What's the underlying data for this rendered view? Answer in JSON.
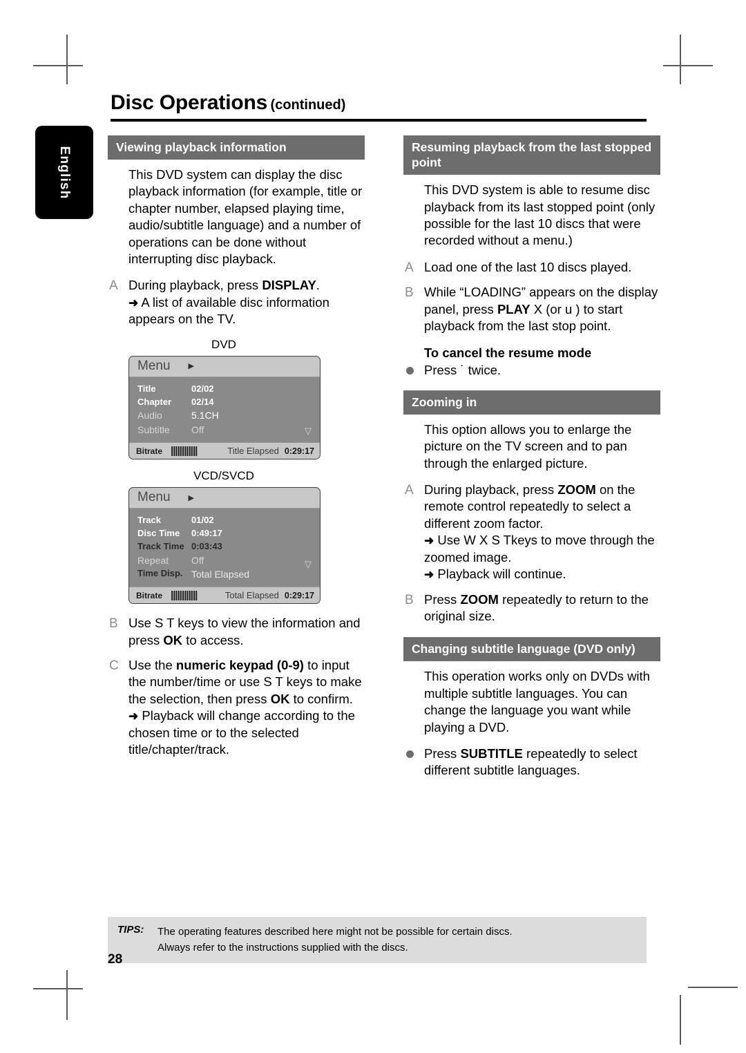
{
  "page": {
    "title_main": "Disc Operations",
    "title_sub": "(continued)",
    "language_tab": "English",
    "page_number": "28"
  },
  "left_column": {
    "section": {
      "heading": "Viewing playback information",
      "intro": "This DVD system can display the disc playback information (for example, title or chapter number, elapsed playing time, audio/subtitle language) and a number of operations can be done without interrupting disc playback.",
      "step_a": {
        "marker": "A",
        "text_before": "During playback, press ",
        "bold": "DISPLAY",
        "text_after": ".",
        "result_arrow": "➜",
        "result": "A list of available disc information appears on the TV."
      },
      "step_b": {
        "marker": "B",
        "text_before": "Use  S T keys to view the information and press ",
        "bold": "OK",
        "text_after": " to access."
      },
      "step_c": {
        "marker": "C",
        "part1": "Use the ",
        "bold1": "numeric keypad (0-9)",
        "part2": " to input the number/time or use  S T keys to make the selection, then press ",
        "bold2": "OK",
        "part3": " to confirm.",
        "result_arrow": "➜",
        "result": "Playback will change according to the chosen time or to the selected title/chapter/track."
      }
    },
    "osd_dvd": {
      "caption": "DVD",
      "menu_label": "Menu",
      "caret": "▶",
      "rows": [
        {
          "key": "Title",
          "value": "02/02",
          "style": "hl"
        },
        {
          "key": "Chapter",
          "value": "02/14",
          "style": "hl"
        },
        {
          "key": "Audio",
          "value": "5.1CH",
          "style": "dim"
        },
        {
          "key": "Subtitle",
          "value": "Off",
          "style": "dim"
        }
      ],
      "down_arrow": "▽",
      "footer": {
        "bitrate_label": "Bitrate",
        "bitrate_bars": "||||||||||||",
        "elapsed_label": "Title Elapsed",
        "elapsed_value": "0:29:17"
      }
    },
    "osd_vcd": {
      "caption": "VCD/SVCD",
      "menu_label": "Menu",
      "caret": "▶",
      "rows": [
        {
          "key": "Track",
          "value": "01/02",
          "style": "hl"
        },
        {
          "key": "Disc Time",
          "value": "0:49:17",
          "style": "hl"
        },
        {
          "key": "Track Time",
          "value": "0:03:43",
          "style": "dark"
        },
        {
          "key": "Repeat",
          "value": "Off",
          "style": "dim"
        },
        {
          "key": "Time Disp.",
          "value": "Total Elapsed",
          "style": "dim"
        }
      ],
      "down_arrow": "▽",
      "footer": {
        "bitrate_label": "Bitrate",
        "bitrate_bars": "||||||||||||",
        "elapsed_label": "Total Elapsed",
        "elapsed_value": "0:29:17"
      }
    }
  },
  "right_column": {
    "resume": {
      "heading": "Resuming playback from the last stopped point",
      "intro": "This DVD system is able to resume disc playback from its last stopped point (only possible for the last 10 discs that were recorded without a menu.)",
      "step_a": {
        "marker": "A",
        "text": "Load one of the last 10 discs played."
      },
      "step_b": {
        "marker": "B",
        "part1": "While “LOADING” appears on the display panel, press ",
        "bold": "PLAY",
        "part2": "  X (or u    ) to start playback from the last stop point."
      },
      "cancel_heading": "To cancel the resume mode",
      "cancel_text": "Press  ˙    twice."
    },
    "zooming": {
      "heading": "Zooming in",
      "intro": "This option allows you to enlarge the picture on the TV screen and to pan through the enlarged picture.",
      "step_a": {
        "marker": "A",
        "part1": "During playback, press ",
        "bold": "ZOOM",
        "part2": " on the remote control repeatedly to select a different zoom factor.",
        "result_arrow1": "➜",
        "result1": "Use  W X S Tkeys to move through the zoomed image.",
        "result_arrow2": "➜",
        "result2": "Playback will continue."
      },
      "step_b": {
        "marker": "B",
        "part1": "Press ",
        "bold": "ZOOM",
        "part2": " repeatedly to return to the original size."
      }
    },
    "subtitle": {
      "heading": "Changing subtitle language (DVD only)",
      "intro": "This operation works only on DVDs with multiple subtitle languages. You can change the language you want while playing a DVD.",
      "bullet": {
        "part1": "Press ",
        "bold": "SUBTITLE",
        "part2": " repeatedly to select different subtitle languages."
      }
    }
  },
  "tips": {
    "label": "TIPS:",
    "line1": "The operating features described here might not be possible for certain discs.",
    "line2": "Always refer to the instructions supplied with the discs."
  }
}
